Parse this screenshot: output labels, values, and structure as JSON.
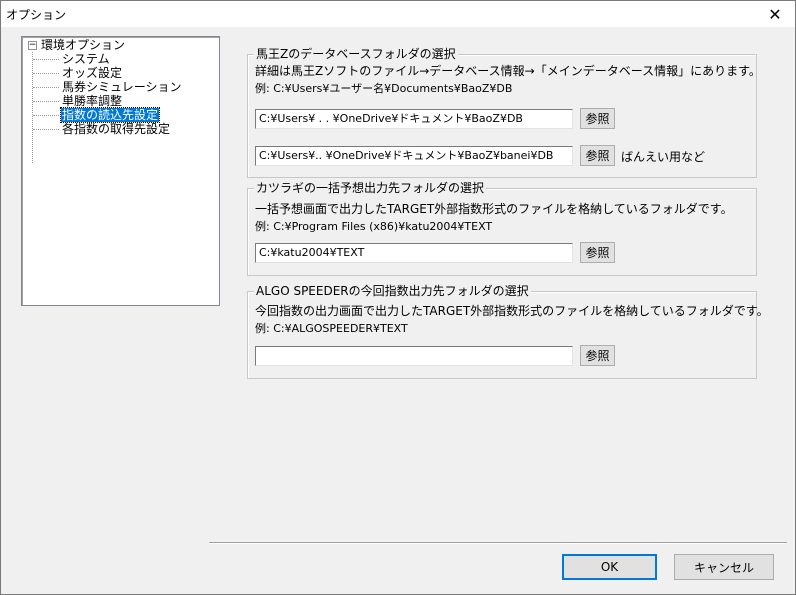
{
  "window": {
    "title": "オプション"
  },
  "tree": {
    "root": "環境オプション",
    "items": [
      {
        "label": "システム",
        "selected": false
      },
      {
        "label": "オッズ設定",
        "selected": false
      },
      {
        "label": "馬券シミュレーション",
        "selected": false
      },
      {
        "label": "単勝率調整",
        "selected": false
      },
      {
        "label": "指数の読込先設定",
        "selected": true
      },
      {
        "label": "各指数の取得先設定",
        "selected": false
      }
    ]
  },
  "baoz": {
    "title": "馬王Zのデータベースフォルダの選択",
    "description": "詳細は馬王Zソフトのファイル→データベース情報→「メインデータベース情報」にあります。",
    "example": "例:  C:¥Users¥ユーザー名¥Documents¥BaoZ¥DB",
    "path1": "C:¥Users¥  .  .  ¥OneDrive¥ドキュメント¥BaoZ¥DB",
    "path2": "C:¥Users¥..     ¥OneDrive¥ドキュメント¥BaoZ¥banei¥DB",
    "browse": "参照",
    "note": "ばんえい用など"
  },
  "katu": {
    "title": "カツラギの一括予想出力先フォルダの選択",
    "description": "一括予想画面で出力したTARGET外部指数形式のファイルを格納しているフォルダです。",
    "example": "例:  C:¥Program Files (x86)¥katu2004¥TEXT",
    "path": "C:¥katu2004¥TEXT",
    "browse": "参照"
  },
  "algo": {
    "title": "ALGO SPEEDERの今回指数出力先フォルダの選択",
    "description": "今回指数の出力画面で出力したTARGET外部指数形式のファイルを格納しているフォルダです。",
    "example": "例:  C:¥ALGOSPEEDER¥TEXT",
    "path": "",
    "browse": "参照"
  },
  "footer": {
    "ok": "OK",
    "cancel": "キャンセル"
  },
  "colors": {
    "selection": "#0078d7",
    "window_bg": "#f0f0f0"
  }
}
